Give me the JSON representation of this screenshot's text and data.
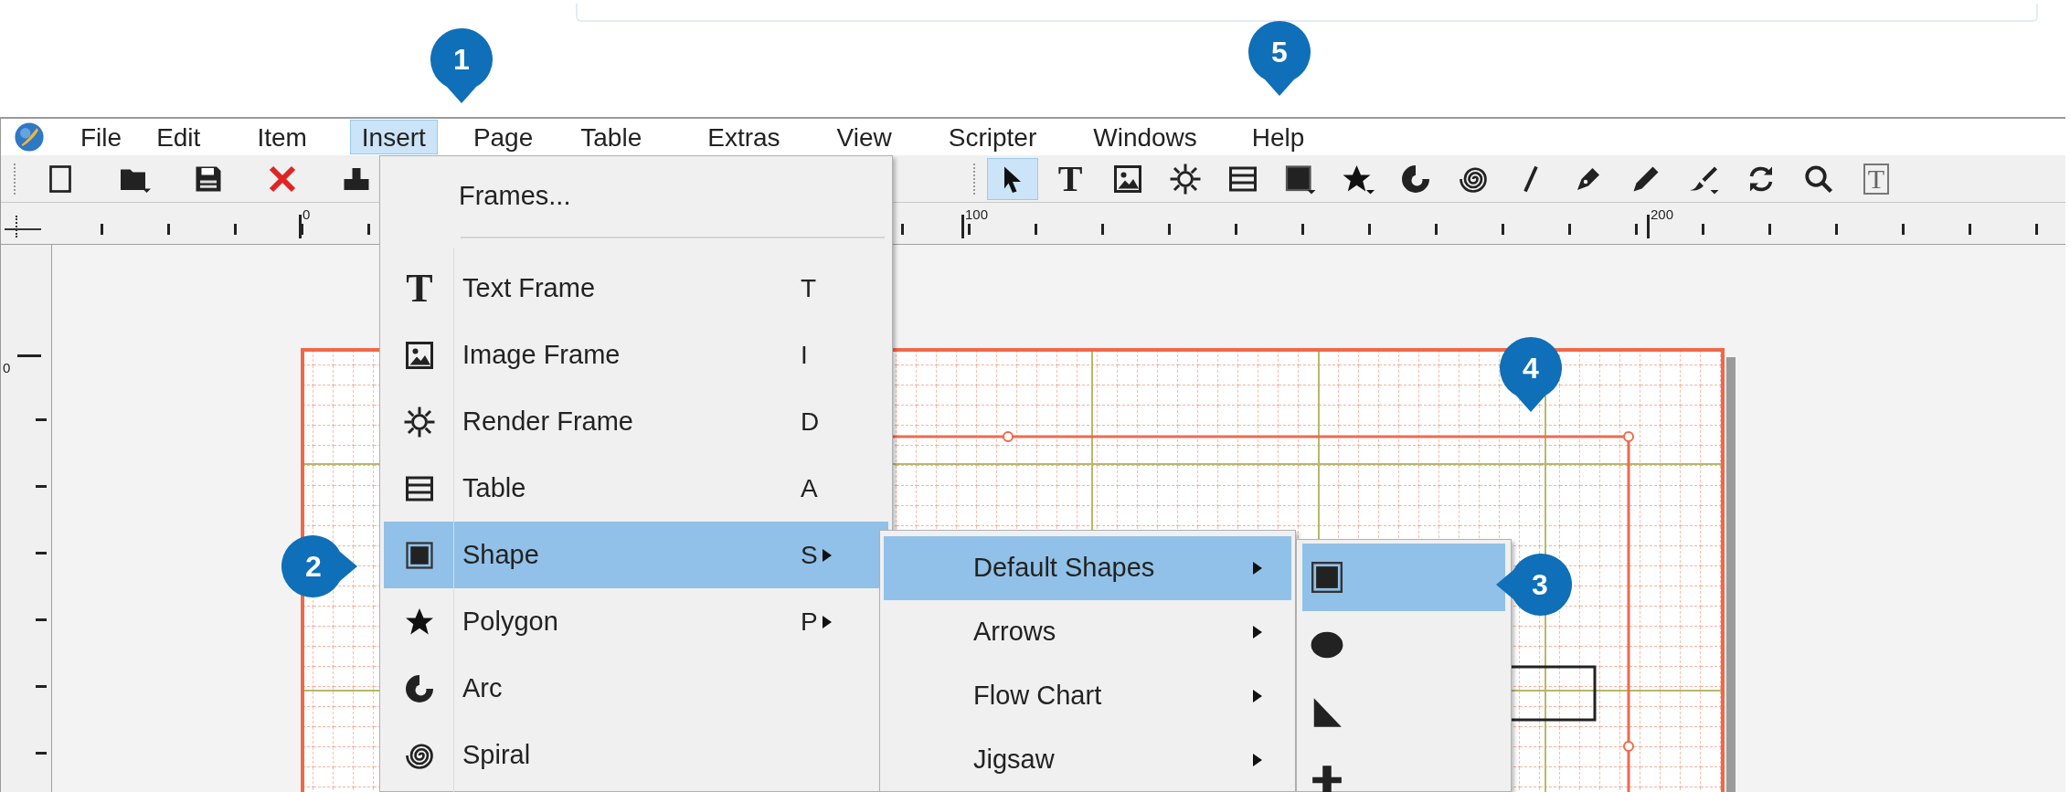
{
  "menu_bar": {
    "items": [
      {
        "label": "File",
        "selected": false
      },
      {
        "label": "Edit",
        "selected": false
      },
      {
        "label": "Item",
        "selected": false
      },
      {
        "label": "Insert",
        "selected": true
      },
      {
        "label": "Page",
        "selected": false
      },
      {
        "label": "Table",
        "selected": false
      },
      {
        "label": "Extras",
        "selected": false
      },
      {
        "label": "View",
        "selected": false
      },
      {
        "label": "Scripter",
        "selected": false
      },
      {
        "label": "Windows",
        "selected": false
      },
      {
        "label": "Help",
        "selected": false
      }
    ]
  },
  "toolbar": {
    "left_tools": [
      {
        "kind": "new",
        "selected": false
      },
      {
        "kind": "open",
        "selected": false
      },
      {
        "kind": "save",
        "selected": false
      },
      {
        "kind": "close",
        "selected": false
      },
      {
        "kind": "print",
        "selected": false
      }
    ],
    "right_tools": [
      {
        "kind": "select",
        "selected": true
      },
      {
        "kind": "text",
        "glyph": "T",
        "selected": false
      },
      {
        "kind": "image",
        "selected": false
      },
      {
        "kind": "render",
        "selected": false
      },
      {
        "kind": "table",
        "selected": false
      },
      {
        "kind": "shape",
        "selected": false
      },
      {
        "kind": "polygon",
        "selected": false
      },
      {
        "kind": "arc",
        "selected": false
      },
      {
        "kind": "spiral",
        "selected": false
      },
      {
        "kind": "line",
        "selected": false
      },
      {
        "kind": "bezier",
        "selected": false
      },
      {
        "kind": "pencil",
        "selected": false
      },
      {
        "kind": "calligraphy",
        "selected": false
      },
      {
        "kind": "rotate",
        "selected": false
      },
      {
        "kind": "zoom",
        "selected": false
      },
      {
        "kind": "textbox",
        "glyph": "T",
        "selected": false
      }
    ]
  },
  "ruler": {
    "top_labels": [
      "0",
      "100",
      "200"
    ],
    "left_labels": [
      "0"
    ]
  },
  "insert_menu": {
    "items": [
      {
        "kind": "plain",
        "label": "Frames...",
        "has_submenu": false,
        "selected": false
      },
      {
        "kind": "text",
        "glyph": "T",
        "label": "Text Frame",
        "shortcut": "T",
        "has_submenu": false,
        "selected": false
      },
      {
        "kind": "image",
        "label": "Image Frame",
        "shortcut": "I",
        "has_submenu": false,
        "selected": false
      },
      {
        "kind": "render",
        "label": "Render Frame",
        "shortcut": "D",
        "has_submenu": false,
        "selected": false
      },
      {
        "kind": "table",
        "label": "Table",
        "shortcut": "A",
        "has_submenu": false,
        "selected": false
      },
      {
        "kind": "shape",
        "label": "Shape",
        "shortcut": "S",
        "has_submenu": true,
        "selected": true
      },
      {
        "kind": "polygon",
        "label": "Polygon",
        "shortcut": "P",
        "has_submenu": true,
        "selected": false
      },
      {
        "kind": "arc",
        "label": "Arc",
        "has_submenu": false,
        "selected": false
      },
      {
        "kind": "spiral",
        "label": "Spiral",
        "has_submenu": false,
        "selected": false
      }
    ]
  },
  "shape_submenu": {
    "items": [
      {
        "label": "Default Shapes",
        "selected": true
      },
      {
        "label": "Arrows",
        "selected": false
      },
      {
        "label": "Flow Chart",
        "selected": false
      },
      {
        "label": "Jigsaw",
        "selected": false
      }
    ]
  },
  "default_shapes_submenu": {
    "items": [
      {
        "kind": "square",
        "selected": true
      },
      {
        "kind": "ellipse",
        "selected": false
      },
      {
        "kind": "triangle",
        "selected": false
      },
      {
        "kind": "cross",
        "selected": false
      }
    ]
  },
  "callouts": [
    {
      "number": "1",
      "kind": "down"
    },
    {
      "number": "5",
      "kind": "down"
    },
    {
      "number": "2",
      "kind": "right"
    },
    {
      "number": "3",
      "kind": "left"
    },
    {
      "number": "4",
      "kind": "down"
    }
  ]
}
